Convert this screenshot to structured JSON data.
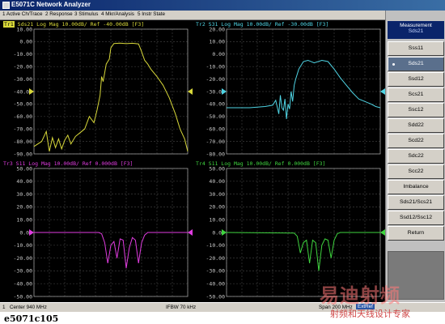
{
  "window": {
    "title": "E5071C Network Analyzer"
  },
  "menu": [
    "1 Active Ch/Trace",
    "2 Response",
    "3 Stimulus",
    "4 Mkr/Analysis",
    "5 Instr State"
  ],
  "softkeys": {
    "header_title": "Measurement",
    "header_value": "Sds21",
    "buttons": [
      {
        "label": "Sss11",
        "selected": false
      },
      {
        "label": "Sds21",
        "selected": true
      },
      {
        "label": "Ssd12",
        "selected": false
      },
      {
        "label": "Scs21",
        "selected": false
      },
      {
        "label": "Ssc12",
        "selected": false
      },
      {
        "label": "Sdd22",
        "selected": false
      },
      {
        "label": "Scd22",
        "selected": false
      },
      {
        "label": "Sdc22",
        "selected": false
      },
      {
        "label": "Scc22",
        "selected": false
      },
      {
        "label": "Imbalance",
        "selected": false
      },
      {
        "label": "Sds21/Scs21",
        "selected": false
      },
      {
        "label": "Ssd12/Ssc12",
        "selected": false
      },
      {
        "label": "Return",
        "selected": false
      }
    ]
  },
  "traces": [
    {
      "id": "trace1",
      "header": "Sds21 Log Mag 10.00dB/ Ref -40.00dB [F3]",
      "tag": "Tr1",
      "tag_active": true,
      "color": "#d8d83a",
      "ref_value": -40,
      "ref_label": "-40.00",
      "yticks": [
        "10.00",
        "0.00",
        "-10.00",
        "-20.00",
        "-30.00",
        "-40.00",
        "-50.00",
        "-60.00",
        "-70.00",
        "-80.00",
        "-90.00"
      ],
      "curve": [
        [
          0,
          -84
        ],
        [
          0.05,
          -80
        ],
        [
          0.08,
          -72
        ],
        [
          0.1,
          -88
        ],
        [
          0.12,
          -77
        ],
        [
          0.14,
          -85
        ],
        [
          0.16,
          -78
        ],
        [
          0.18,
          -86
        ],
        [
          0.2,
          -79
        ],
        [
          0.22,
          -75
        ],
        [
          0.24,
          -82
        ],
        [
          0.27,
          -76
        ],
        [
          0.3,
          -73
        ],
        [
          0.33,
          -70
        ],
        [
          0.36,
          -60
        ],
        [
          0.39,
          -65
        ],
        [
          0.41,
          -55
        ],
        [
          0.43,
          -43
        ],
        [
          0.44,
          -28
        ],
        [
          0.45,
          -32
        ],
        [
          0.47,
          -18
        ],
        [
          0.49,
          -14
        ],
        [
          0.5,
          -5
        ],
        [
          0.52,
          -1.5
        ],
        [
          0.56,
          -1.2
        ],
        [
          0.6,
          -1.6
        ],
        [
          0.64,
          -1.3
        ],
        [
          0.68,
          -1.8
        ],
        [
          0.7,
          -8
        ],
        [
          0.72,
          -15
        ],
        [
          0.74,
          -18
        ],
        [
          0.76,
          -22
        ],
        [
          0.8,
          -28
        ],
        [
          0.84,
          -35
        ],
        [
          0.88,
          -45
        ],
        [
          0.92,
          -58
        ],
        [
          0.95,
          -70
        ],
        [
          0.98,
          -78
        ],
        [
          1,
          -88
        ]
      ]
    },
    {
      "id": "trace2",
      "header": "Tr2 S31 Log Mag 10.00dB/ Ref -30.00dB [F3]",
      "tag": "",
      "tag_active": false,
      "color": "#4fd4e4",
      "ref_value": -30,
      "ref_label": "-30.00",
      "yticks": [
        "20.00",
        "10.00",
        "0.00",
        "-10.00",
        "-20.00",
        "-30.00",
        "-40.00",
        "-50.00",
        "-60.00",
        "-70.00",
        "-80.00"
      ],
      "curve": [
        [
          0,
          -43
        ],
        [
          0.15,
          -43
        ],
        [
          0.25,
          -42
        ],
        [
          0.3,
          -41
        ],
        [
          0.32,
          -37
        ],
        [
          0.34,
          -48
        ],
        [
          0.35,
          -33
        ],
        [
          0.36,
          -43
        ],
        [
          0.37,
          -45
        ],
        [
          0.38,
          -36
        ],
        [
          0.39,
          -52
        ],
        [
          0.4,
          -40
        ],
        [
          0.41,
          -44
        ],
        [
          0.42,
          -30
        ],
        [
          0.43,
          -38
        ],
        [
          0.44,
          -25
        ],
        [
          0.45,
          -20
        ],
        [
          0.47,
          -12
        ],
        [
          0.5,
          -6
        ],
        [
          0.53,
          -5
        ],
        [
          0.57,
          -7
        ],
        [
          0.62,
          -5
        ],
        [
          0.66,
          -6
        ],
        [
          0.7,
          -12
        ],
        [
          0.74,
          -19
        ],
        [
          0.78,
          -25
        ],
        [
          0.82,
          -31
        ],
        [
          0.86,
          -36
        ],
        [
          0.9,
          -38
        ],
        [
          0.94,
          -40
        ],
        [
          0.97,
          -42
        ],
        [
          1,
          -43
        ]
      ]
    },
    {
      "id": "trace3",
      "header": "Tr3 S11 Log Mag 10.00dB/ Ref 0.000dB [F3]",
      "tag": "",
      "tag_active": false,
      "color": "#e03ce0",
      "ref_value": 0,
      "ref_label": "0.00",
      "yticks": [
        "50.00",
        "40.00",
        "30.00",
        "20.00",
        "10.00",
        "0.00",
        "-10.00",
        "-20.00",
        "-30.00",
        "-40.00",
        "-50.00"
      ],
      "curve": [
        [
          0,
          0
        ],
        [
          0.42,
          0
        ],
        [
          0.44,
          -1
        ],
        [
          0.46,
          -8
        ],
        [
          0.48,
          -24
        ],
        [
          0.5,
          -10
        ],
        [
          0.52,
          -7
        ],
        [
          0.54,
          -20
        ],
        [
          0.56,
          -5
        ],
        [
          0.58,
          -6
        ],
        [
          0.6,
          -28
        ],
        [
          0.62,
          -12
        ],
        [
          0.64,
          -4
        ],
        [
          0.66,
          -6
        ],
        [
          0.68,
          -24
        ],
        [
          0.7,
          -8
        ],
        [
          0.72,
          -2
        ],
        [
          0.74,
          0
        ],
        [
          1,
          0
        ]
      ]
    },
    {
      "id": "trace4",
      "header": "Tr4 S11 Log Mag 10.00dB/ Ref 0.000dB [F3]",
      "tag": "",
      "tag_active": false,
      "color": "#3fd43f",
      "ref_value": 0,
      "ref_label": "0.00",
      "yticks": [
        "50.00",
        "40.00",
        "30.00",
        "20.00",
        "10.00",
        "0.00",
        "-10.00",
        "-20.00",
        "-30.00",
        "-40.00",
        "-50.00"
      ],
      "curve": [
        [
          0,
          0
        ],
        [
          0.44,
          -0.5
        ],
        [
          0.46,
          -3
        ],
        [
          0.48,
          -16
        ],
        [
          0.5,
          -8
        ],
        [
          0.52,
          -6
        ],
        [
          0.54,
          -24
        ],
        [
          0.56,
          -6
        ],
        [
          0.58,
          -8
        ],
        [
          0.6,
          -30
        ],
        [
          0.62,
          -10
        ],
        [
          0.64,
          -5
        ],
        [
          0.66,
          -6
        ],
        [
          0.68,
          -20
        ],
        [
          0.7,
          -6
        ],
        [
          0.72,
          -1
        ],
        [
          0.74,
          0
        ],
        [
          1,
          0
        ]
      ]
    }
  ],
  "status": {
    "channel": "1",
    "center": "Center 940 MHz",
    "ifbw": "IFBW 70 kHz",
    "span": "Span 200 MHz",
    "extref": "ExtRef"
  },
  "caption": "e5071c105",
  "watermark": {
    "big": "易迪射频",
    "small": "射频和天线设计专家"
  }
}
